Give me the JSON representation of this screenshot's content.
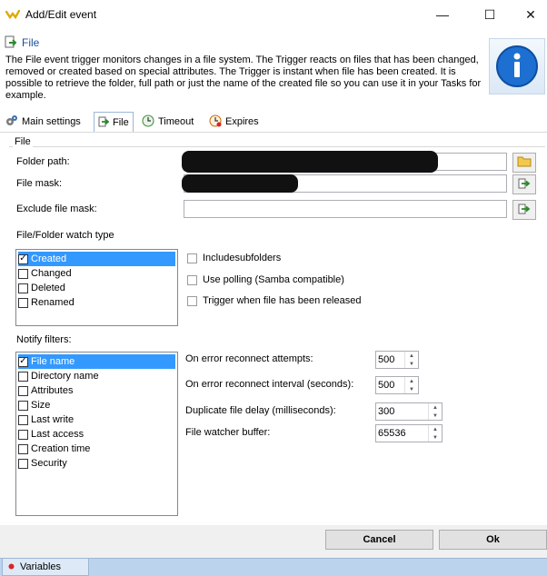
{
  "window": {
    "title": "Add/Edit event",
    "minimize_glyph": "—",
    "maximize_glyph": "☐",
    "close_glyph": "✕"
  },
  "header": {
    "title": "File",
    "description": "The File event trigger monitors changes in a file system. The Trigger reacts on files that has been changed, removed or created based on special attributes. The Trigger is instant when file has been created. It is possible to retrieve the folder, full path or just the name of the created file so you can use it in your Tasks for example."
  },
  "tabs": [
    {
      "label": "Main settings",
      "icon": "gears-icon",
      "active": false
    },
    {
      "label": "File",
      "icon": "arrow-icon",
      "active": true
    },
    {
      "label": "Timeout",
      "icon": "clock-icon",
      "active": false
    },
    {
      "label": "Expires",
      "icon": "clock-stop-icon",
      "active": false
    }
  ],
  "file_group": {
    "label": "File",
    "folder_path_label": "Folder path:",
    "file_mask_label": "File mask:",
    "exclude_mask_label": "Exclude file mask:",
    "folder_path_value": "",
    "file_mask_value": "",
    "exclude_mask_value": ""
  },
  "watch_type": {
    "label": "File/Folder watch type",
    "items": [
      {
        "label": "Created",
        "checked": true,
        "selected": true
      },
      {
        "label": "Changed",
        "checked": false,
        "selected": false
      },
      {
        "label": "Deleted",
        "checked": false,
        "selected": false
      },
      {
        "label": "Renamed",
        "checked": false,
        "selected": false
      }
    ]
  },
  "options": {
    "include_subfolders": "Includesubfolders",
    "use_polling": "Use polling (Samba compatible)",
    "trigger_released": "Trigger when file has been released"
  },
  "notify_filters": {
    "label": "Notify filters:",
    "items": [
      {
        "label": "File name",
        "checked": true,
        "selected": true
      },
      {
        "label": "Directory name",
        "checked": false,
        "selected": false
      },
      {
        "label": "Attributes",
        "checked": false,
        "selected": false
      },
      {
        "label": "Size",
        "checked": false,
        "selected": false
      },
      {
        "label": "Last write",
        "checked": false,
        "selected": false
      },
      {
        "label": "Last access",
        "checked": false,
        "selected": false
      },
      {
        "label": "Creation time",
        "checked": false,
        "selected": false
      },
      {
        "label": "Security",
        "checked": false,
        "selected": false
      }
    ]
  },
  "spinners": {
    "reconnect_attempts_label": "On error reconnect attempts:",
    "reconnect_attempts_value": "500",
    "reconnect_interval_label": "On error reconnect interval (seconds):",
    "reconnect_interval_value": "500",
    "duplicate_delay_label": "Duplicate file delay (milliseconds):",
    "duplicate_delay_value": "300",
    "buffer_label": "File watcher buffer:",
    "buffer_value": "65536"
  },
  "buttons": {
    "cancel": "Cancel",
    "ok": "Ok"
  },
  "statusbar": {
    "variables": "Variables"
  },
  "colors": {
    "selection": "#3399ff",
    "header_title": "#1a4e9b",
    "statusbar": "#bcd3ee"
  }
}
